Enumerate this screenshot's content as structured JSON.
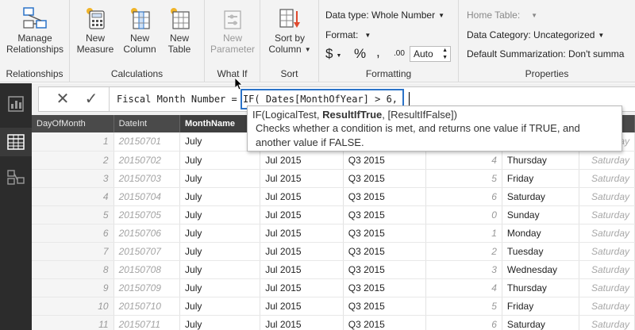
{
  "ribbon": {
    "relationships": {
      "button_line1": "Manage",
      "button_line2": "Relationships",
      "group_label": "Relationships"
    },
    "calculations": {
      "new_measure": {
        "line1": "New",
        "line2": "Measure"
      },
      "new_column": {
        "line1": "New",
        "line2": "Column"
      },
      "new_table": {
        "line1": "New",
        "line2": "Table"
      },
      "group_label": "Calculations"
    },
    "whatif": {
      "new_parameter": {
        "line1": "New",
        "line2": "Parameter"
      },
      "group_label": "What If"
    },
    "sort": {
      "sort_by_column": {
        "line1": "Sort by",
        "line2": "Column"
      },
      "group_label": "Sort"
    },
    "formatting": {
      "data_type": "Data type: Whole Number",
      "format": "Format:",
      "currency_symbol": "$",
      "percent_symbol": "%",
      "comma_symbol": ",",
      "decimal_symbol": ".00",
      "auto_value": "Auto",
      "group_label": "Formatting"
    },
    "properties": {
      "home_table": "Home Table:",
      "data_category": "Data Category: Uncategorized",
      "default_summarization": "Default Summarization: Don't summa",
      "group_label": "Properties"
    }
  },
  "formula_bar": {
    "prefix": "Fiscal Month Number = ",
    "highlighted": "IF( Dates[MonthOfYear] > 6,"
  },
  "tooltip": {
    "signature_start": "IF(LogicalTest, ",
    "signature_bold": "ResultIfTrue",
    "signature_end": ", [ResultIfFalse])",
    "description_line1": "Checks whether a condition is met, and returns one value if TRUE, and",
    "description_line2": "another value if FALSE."
  },
  "grid": {
    "headers": [
      "DayOfMonth",
      "DateInt",
      "MonthName",
      "",
      "",
      "",
      "",
      "din"
    ],
    "rows": [
      [
        "1",
        "20150701",
        "July",
        "",
        "",
        "",
        "",
        "Saturday"
      ],
      [
        "2",
        "20150702",
        "July",
        "Jul 2015",
        "Q3 2015",
        "4",
        "Thursday",
        "Saturday"
      ],
      [
        "3",
        "20150703",
        "July",
        "Jul 2015",
        "Q3 2015",
        "5",
        "Friday",
        "Saturday"
      ],
      [
        "4",
        "20150704",
        "July",
        "Jul 2015",
        "Q3 2015",
        "6",
        "Saturday",
        "Saturday"
      ],
      [
        "5",
        "20150705",
        "July",
        "Jul 2015",
        "Q3 2015",
        "0",
        "Sunday",
        "Saturday"
      ],
      [
        "6",
        "20150706",
        "July",
        "Jul 2015",
        "Q3 2015",
        "1",
        "Monday",
        "Saturday"
      ],
      [
        "7",
        "20150707",
        "July",
        "Jul 2015",
        "Q3 2015",
        "2",
        "Tuesday",
        "Saturday"
      ],
      [
        "8",
        "20150708",
        "July",
        "Jul 2015",
        "Q3 2015",
        "3",
        "Wednesday",
        "Saturday"
      ],
      [
        "9",
        "20150709",
        "July",
        "Jul 2015",
        "Q3 2015",
        "4",
        "Thursday",
        "Saturday"
      ],
      [
        "10",
        "20150710",
        "July",
        "Jul 2015",
        "Q3 2015",
        "5",
        "Friday",
        "Saturday"
      ],
      [
        "11",
        "20150711",
        "July",
        "Jul 2015",
        "Q3 2015",
        "6",
        "Saturday",
        "Saturday"
      ]
    ]
  },
  "colors": {
    "accent_blue": "#2b73c8",
    "grid_header": "#4a4a4a",
    "left_bar": "#2c2c2c"
  }
}
